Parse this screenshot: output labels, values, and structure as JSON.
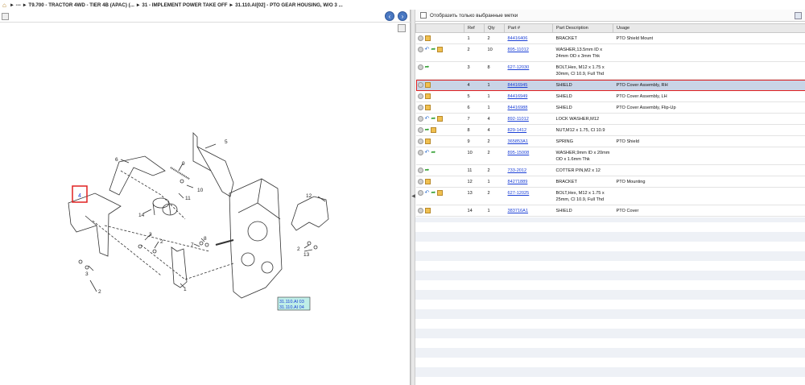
{
  "breadcrumb": {
    "home_icon": "home-icon",
    "text": "► --- ► T9.700 - TRACTOR 4WD - TIER 4B (APAC) (... ► 31 - IMPLEMENT POWER TAKE OFF ► 31.110.AI[02] - PTO GEAR HOUSING, W/O 3 ..."
  },
  "filter": {
    "label": "Отобразить только выбранные метки"
  },
  "table": {
    "headers": [
      "",
      "Ref",
      "Qty",
      "Part #",
      "Part Description",
      "Usage"
    ],
    "rows": [
      {
        "icons": [
          "circle",
          "box"
        ],
        "ref": "1",
        "qty": "2",
        "part": "84416406",
        "desc": "BRACKET",
        "usage": "PTO Shield Mount"
      },
      {
        "icons": [
          "circle",
          "blue",
          "green",
          "box"
        ],
        "ref": "2",
        "qty": "10",
        "part": "895-11012",
        "desc": "WASHER,13.5mm ID x 24mm OD x 3mm Thk",
        "usage": ""
      },
      {
        "icons": [
          "circle",
          "green"
        ],
        "ref": "3",
        "qty": "8",
        "part": "627-12030",
        "desc": "BOLT,Hex, M12 x 1.75 x 30mm, Cl 10.9, Full Thd",
        "usage": ""
      },
      {
        "icons": [
          "circle",
          "box"
        ],
        "ref": "4",
        "qty": "1",
        "part": "84416945",
        "desc": "SHIELD",
        "usage": "PTO Cover Assembly, RH",
        "selected": true
      },
      {
        "icons": [
          "circle",
          "box"
        ],
        "ref": "5",
        "qty": "1",
        "part": "84416949",
        "desc": "SHIELD",
        "usage": "PTO Cover Assembly, LH"
      },
      {
        "icons": [
          "circle",
          "box"
        ],
        "ref": "6",
        "qty": "1",
        "part": "84416988",
        "desc": "SHIELD",
        "usage": "PTO Cover Assembly, Flip-Up"
      },
      {
        "icons": [
          "circle",
          "blue",
          "green",
          "box"
        ],
        "ref": "7",
        "qty": "4",
        "part": "892-11012",
        "desc": "LOCK WASHER,M12",
        "usage": ""
      },
      {
        "icons": [
          "circle",
          "green",
          "box"
        ],
        "ref": "8",
        "qty": "4",
        "part": "829-1412",
        "desc": "NUT,M12 x 1.75, Cl 10.9",
        "usage": ""
      },
      {
        "icons": [
          "circle",
          "box"
        ],
        "ref": "9",
        "qty": "2",
        "part": "365853A1",
        "desc": "SPRING",
        "usage": "PTO Shield"
      },
      {
        "icons": [
          "circle",
          "blue",
          "green"
        ],
        "ref": "10",
        "qty": "2",
        "part": "895-15008",
        "desc": "WASHER,9mm ID x 20mm OD x 1.6mm Thk",
        "usage": ""
      },
      {
        "icons": [
          "circle",
          "green"
        ],
        "ref": "11",
        "qty": "2",
        "part": "733-2012",
        "desc": "COTTER PIN,M2 x 12",
        "usage": ""
      },
      {
        "icons": [
          "circle",
          "box"
        ],
        "ref": "12",
        "qty": "1",
        "part": "84271889",
        "desc": "BRACKET",
        "usage": "PTO Mounting"
      },
      {
        "icons": [
          "circle",
          "blue",
          "green",
          "box"
        ],
        "ref": "13",
        "qty": "2",
        "part": "627-12025",
        "desc": "BOLT,Hex, M12 x 1.75 x 25mm, Cl 10.9, Full Thd",
        "usage": ""
      },
      {
        "icons": [
          "circle",
          "box"
        ],
        "ref": "14",
        "qty": "1",
        "part": "383716A1",
        "desc": "SHIELD",
        "usage": "PTO Cover"
      }
    ]
  },
  "diagram": {
    "callouts": [
      "1",
      "2",
      "3",
      "4",
      "5",
      "6",
      "7",
      "8",
      "9",
      "10",
      "11",
      "12",
      "13",
      "14"
    ],
    "links": [
      "31.110.AI 03",
      "31.110.AI 04"
    ]
  },
  "colors": {
    "selected_row": "#c9d4e6",
    "highlight": "#e02020",
    "link": "#1a3fd6",
    "nav_button": "#4a78c2"
  }
}
